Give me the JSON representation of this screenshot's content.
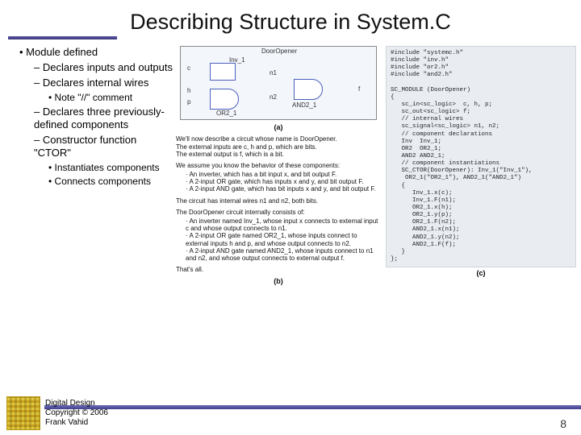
{
  "title": "Describing Structure in System.C",
  "left": {
    "l1": "Module defined",
    "l2a": "Declares inputs and outputs",
    "l2b": "Declares internal wires",
    "l3a": "Note \"//\" comment",
    "l2c": "Declares three previously-defined components",
    "l2d": "Constructor function \"CTOR\"",
    "l3b": "Instantiates components",
    "l3c": "Connects components"
  },
  "diagram": {
    "top": "DoorOpener",
    "inv": "Inv_1",
    "c": "c",
    "h": "h",
    "p": "p",
    "n1": "n1",
    "n2": "n2",
    "or": "OR2_1",
    "and": "AND2_1",
    "f": "f",
    "cap": "(a)"
  },
  "desc": {
    "p1": "We'll now describe a circuit whose name is DoorOpener.",
    "p1a": "The external inputs are c, h and p, which are bits.",
    "p1b": "The external output is f, which is a bit.",
    "p2": "We assume you know the behavior of these components:",
    "p2a": "An inverter, which has a bit input x, and bit output F.",
    "p2b": "A 2-input OR gate, which has inputs x and y, and bit output F.",
    "p2c": "A 2-input AND gate, which has bit inputs x and y, and bit output F.",
    "p3": "The circuit has internal wires n1 and n2, both bits.",
    "p4": "The DoorOpener circuit internally consists of:",
    "p4a": "An inverter named Inv_1, whose input x connects to external input c and whose output connects to n1.",
    "p4b": "A 2-input OR gate named OR2_1, whose inputs connect to external inputs h and p, and whose output connects to n2.",
    "p4c": "A 2-input AND gate named AND2_1, whose inputs connect to n1 and n2, and whose output connects to external output f.",
    "p5": "That's all.",
    "cap": "(b)"
  },
  "code": {
    "text": "#include \"systemc.h\"\n#include \"inv.h\"\n#include \"or2.h\"\n#include \"and2.h\"\n\nSC_MODULE (DoorOpener)\n{\n   sc_in<sc_logic>  c, h, p;\n   sc_out<sc_logic> f;\n   // internal wires\n   sc_signal<sc_logic> n1, n2;\n   // component declarations\n   Inv  Inv_1;\n   OR2  OR2_1;\n   AND2 AND2_1;\n   // component instantiations\n   SC_CTOR(DoorOpener): Inv_1(\"Inv_1\"),\n    OR2_1(\"OR2_1\"), AND2_1(\"AND2_1\")\n   {\n      Inv_1.x(c);\n      Inv_1.F(n1);\n      OR2_1.x(h);\n      OR2_1.y(p);\n      OR2_1.F(n2);\n      AND2_1.x(n1);\n      AND2_1.y(n2);\n      AND2_1.F(f);\n   }\n};",
    "cap": "(c)"
  },
  "footer": {
    "l1": "Digital Design",
    "l2": "Copyright © 2006",
    "l3": "Frank Vahid",
    "page": "8"
  }
}
